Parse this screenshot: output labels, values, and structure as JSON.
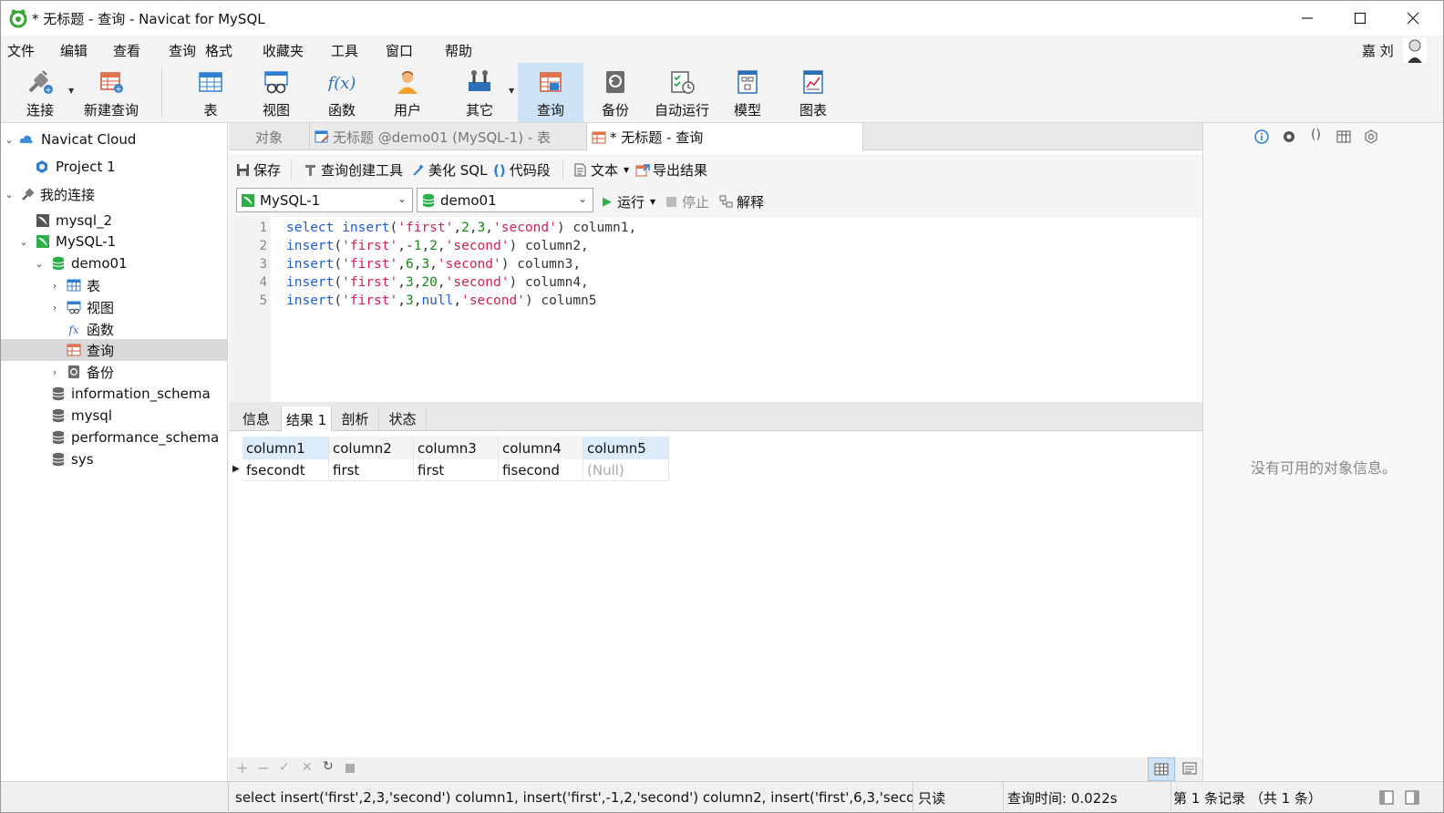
{
  "window": {
    "title": "* 无标题 - 查询 - Navicat for MySQL"
  },
  "menu": [
    "文件",
    "编辑",
    "查看",
    "查询",
    "格式",
    "收藏夹",
    "工具",
    "窗口",
    "帮助"
  ],
  "user": "嘉 刘",
  "toolbar": [
    {
      "label": "连接",
      "icon": "plug-icon"
    },
    {
      "label": "新建查询",
      "icon": "new-query-icon"
    },
    {
      "label": "表",
      "icon": "table-icon"
    },
    {
      "label": "视图",
      "icon": "view-icon"
    },
    {
      "label": "函数",
      "icon": "function-icon"
    },
    {
      "label": "用户",
      "icon": "user-icon"
    },
    {
      "label": "其它",
      "icon": "tools-icon"
    },
    {
      "label": "查询",
      "icon": "query-icon"
    },
    {
      "label": "备份",
      "icon": "backup-icon"
    },
    {
      "label": "自动运行",
      "icon": "auto-run-icon"
    },
    {
      "label": "模型",
      "icon": "model-icon"
    },
    {
      "label": "图表",
      "icon": "chart-icon"
    }
  ],
  "tree": [
    {
      "label": "Navicat Cloud"
    },
    {
      "label": "Project 1"
    },
    {
      "label": "我的连接"
    },
    {
      "label": "mysql_2"
    },
    {
      "label": "MySQL-1"
    },
    {
      "label": "demo01"
    },
    {
      "label": "表"
    },
    {
      "label": "视图"
    },
    {
      "label": "函数"
    },
    {
      "label": "查询"
    },
    {
      "label": "备份"
    },
    {
      "label": "information_schema"
    },
    {
      "label": "mysql"
    },
    {
      "label": "performance_schema"
    },
    {
      "label": "sys"
    }
  ],
  "tabs": {
    "objects": "对象",
    "table_tab": "无标题 @demo01 (MySQL-1) - 表",
    "query_tab": "* 无标题 - 查询"
  },
  "query_toolbar": {
    "save": "保存",
    "builder": "查询创建工具",
    "beautify": "美化 SQL",
    "snippet": "代码段",
    "text": "文本",
    "export": "导出结果",
    "connection": "MySQL-1",
    "database": "demo01",
    "run": "运行",
    "stop": "停止",
    "explain": "解释"
  },
  "editor": {
    "line_numbers": [
      "1",
      "2",
      "3",
      "4",
      "5"
    ],
    "lines": [
      [
        [
          "kw",
          "select"
        ],
        [
          "pl",
          " "
        ],
        [
          "kw",
          "insert"
        ],
        [
          "pl",
          "("
        ],
        [
          "st",
          "'first'"
        ],
        [
          "pl",
          ","
        ],
        [
          "nm",
          "2"
        ],
        [
          "pl",
          ","
        ],
        [
          "nm",
          "3"
        ],
        [
          "pl",
          ","
        ],
        [
          "st",
          "'second'"
        ],
        [
          "pl",
          ") column1,"
        ]
      ],
      [
        [
          "kw",
          "insert"
        ],
        [
          "pl",
          "("
        ],
        [
          "st",
          "'first'"
        ],
        [
          "pl",
          ",-"
        ],
        [
          "nm",
          "1"
        ],
        [
          "pl",
          ","
        ],
        [
          "nm",
          "2"
        ],
        [
          "pl",
          ","
        ],
        [
          "st",
          "'second'"
        ],
        [
          "pl",
          ") column2,"
        ]
      ],
      [
        [
          "kw",
          "insert"
        ],
        [
          "pl",
          "("
        ],
        [
          "st",
          "'first'"
        ],
        [
          "pl",
          ","
        ],
        [
          "nm",
          "6"
        ],
        [
          "pl",
          ","
        ],
        [
          "nm",
          "3"
        ],
        [
          "pl",
          ","
        ],
        [
          "st",
          "'second'"
        ],
        [
          "pl",
          ") column3,"
        ]
      ],
      [
        [
          "kw",
          "insert"
        ],
        [
          "pl",
          "("
        ],
        [
          "st",
          "'first'"
        ],
        [
          "pl",
          ","
        ],
        [
          "nm",
          "3"
        ],
        [
          "pl",
          ","
        ],
        [
          "nm",
          "20"
        ],
        [
          "pl",
          ","
        ],
        [
          "st",
          "'second'"
        ],
        [
          "pl",
          ") column4,"
        ]
      ],
      [
        [
          "kw",
          "insert"
        ],
        [
          "pl",
          "("
        ],
        [
          "st",
          "'first'"
        ],
        [
          "pl",
          ","
        ],
        [
          "nm",
          "3"
        ],
        [
          "pl",
          ","
        ],
        [
          "kw",
          "null"
        ],
        [
          "pl",
          ","
        ],
        [
          "st",
          "'second'"
        ],
        [
          "pl",
          ") column5"
        ]
      ]
    ]
  },
  "result_tabs": [
    "信息",
    "结果 1",
    "剖析",
    "状态"
  ],
  "grid": {
    "columns": [
      "column1",
      "column2",
      "column3",
      "column4",
      "column5"
    ],
    "rows": [
      [
        "fsecondt",
        "first",
        "first",
        "fisecond",
        "(Null)"
      ]
    ]
  },
  "status": {
    "sql": "select insert('first',2,3,'second') column1, insert('first',-1,2,'second') column2, insert('first',6,3,'second') c",
    "readonly": "只读",
    "query_time": "查询时间: 0.022s",
    "records": "第 1 条记录 （共 1 条）"
  },
  "right_panel": {
    "empty_text": "没有可用的对象信息。"
  },
  "colors": {
    "accent": "#cde3f5",
    "keyword": "#1e5bd6",
    "string": "#d0224d",
    "number": "#138a13",
    "connection_green": "#2db04b"
  }
}
